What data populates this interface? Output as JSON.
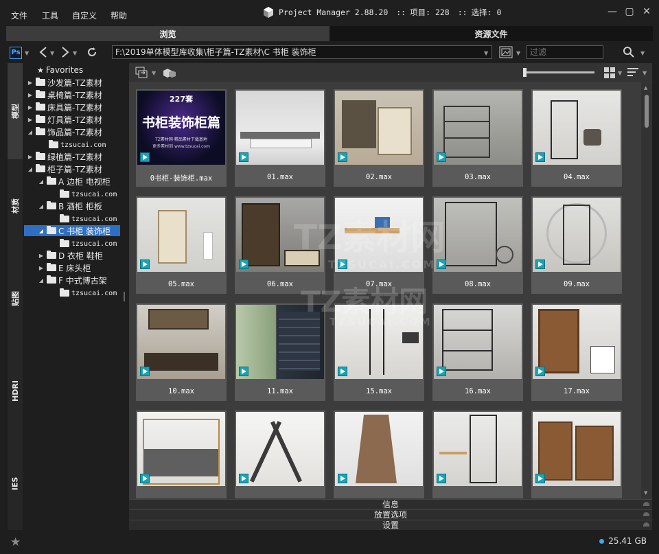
{
  "menu": {
    "file": "文件",
    "tools": "工具",
    "custom": "自定义",
    "help": "帮助"
  },
  "title": {
    "app": "Project Manager 2.88.20",
    "sep1": "::",
    "items_label": "项目: 228",
    "sep2": "::",
    "select_label": "选择: 0"
  },
  "tabs": [
    {
      "label": "浏览"
    },
    {
      "label": "资源文件"
    }
  ],
  "nav": {
    "ps_label": "Ps",
    "path": "F:\\2019单体模型库收集\\柜子篇-TZ素材\\C 书柜 装饰柜",
    "filter_placeholder": "过滤"
  },
  "side_tabs": [
    {
      "label": "模型"
    },
    {
      "label": "材质"
    },
    {
      "label": "贴图"
    },
    {
      "label": "HDRI"
    },
    {
      "label": "IES"
    }
  ],
  "tree": [
    {
      "label": "Favorites"
    },
    {
      "label": "沙发篇-TZ素材"
    },
    {
      "label": "桌椅篇-TZ素材"
    },
    {
      "label": "床具篇-TZ素材"
    },
    {
      "label": "灯具篇-TZ素材"
    },
    {
      "label": "饰品篇-TZ素材"
    },
    {
      "label": "tzsucai.com"
    },
    {
      "label": "绿植篇-TZ素材"
    },
    {
      "label": "柜子篇-TZ素材"
    },
    {
      "label": "A 边柜 电视柜"
    },
    {
      "label": "tzsucai.com"
    },
    {
      "label": "B 酒柜 柜板"
    },
    {
      "label": "tzsucai.com"
    },
    {
      "label": "C 书柜 装饰柜"
    },
    {
      "label": "tzsucai.com"
    },
    {
      "label": "D 衣柜 鞋柜"
    },
    {
      "label": "E 床头柜"
    },
    {
      "label": "F 中式博古架"
    },
    {
      "label": "tzsucai.com"
    }
  ],
  "files": [
    {
      "name": "0书柜-装饰柜.max",
      "cover_count": "227套",
      "cover_title": "书柜装饰柜篇",
      "cover_sub": "TZ素材网·精品素材下载基地",
      "cover_url": "更多素材到 www.tzsucai.com"
    },
    {
      "name": "01.max"
    },
    {
      "name": "02.max"
    },
    {
      "name": "03.max"
    },
    {
      "name": "04.max"
    },
    {
      "name": "05.max"
    },
    {
      "name": "06.max"
    },
    {
      "name": "07.max"
    },
    {
      "name": "08.max"
    },
    {
      "name": "09.max"
    },
    {
      "name": "10.max"
    },
    {
      "name": "11.max"
    },
    {
      "name": "15.max"
    },
    {
      "name": "16.max"
    },
    {
      "name": "17.max"
    },
    {
      "name": ""
    },
    {
      "name": ""
    },
    {
      "name": ""
    },
    {
      "name": ""
    },
    {
      "name": ""
    }
  ],
  "sections": [
    {
      "label": "信息"
    },
    {
      "label": "放置选项"
    },
    {
      "label": "设置"
    }
  ],
  "status": {
    "disk_free": "25.41 GB"
  },
  "watermark": {
    "text1": "TZ素材网",
    "text2": "TZSUCAI.COM"
  },
  "colors": {
    "selection": "#2e6fc4",
    "max_icon": "#16a4b7",
    "disk_dot": "#3fa9f5"
  }
}
